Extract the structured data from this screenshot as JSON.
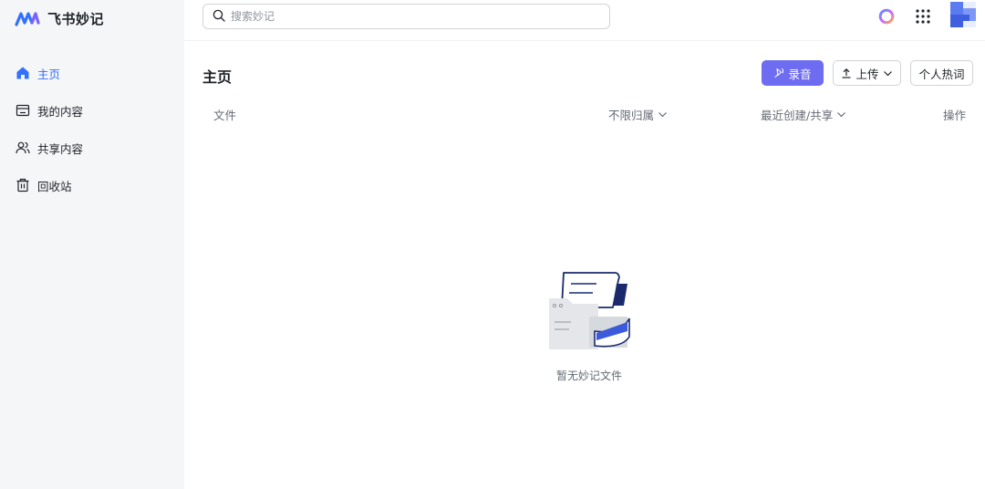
{
  "app": {
    "name": "飞书妙记"
  },
  "search": {
    "placeholder": "搜索妙记"
  },
  "sidebar": {
    "items": [
      {
        "label": "主页",
        "icon": "home-icon",
        "active": true
      },
      {
        "label": "我的内容",
        "icon": "folder-icon",
        "active": false
      },
      {
        "label": "共享内容",
        "icon": "users-icon",
        "active": false
      },
      {
        "label": "回收站",
        "icon": "trash-icon",
        "active": false
      }
    ]
  },
  "main": {
    "title": "主页",
    "buttons": {
      "record": "录音",
      "upload": "上传",
      "hotwords": "个人热词"
    },
    "columns": {
      "file": "文件",
      "owner": "不限归属",
      "recent": "最近创建/共享",
      "action": "操作"
    },
    "empty_text": "暂无妙记文件"
  },
  "colors": {
    "accent": "#3370ff",
    "record": "#6e6cf0",
    "sidebar_bg": "#f5f6f7"
  }
}
